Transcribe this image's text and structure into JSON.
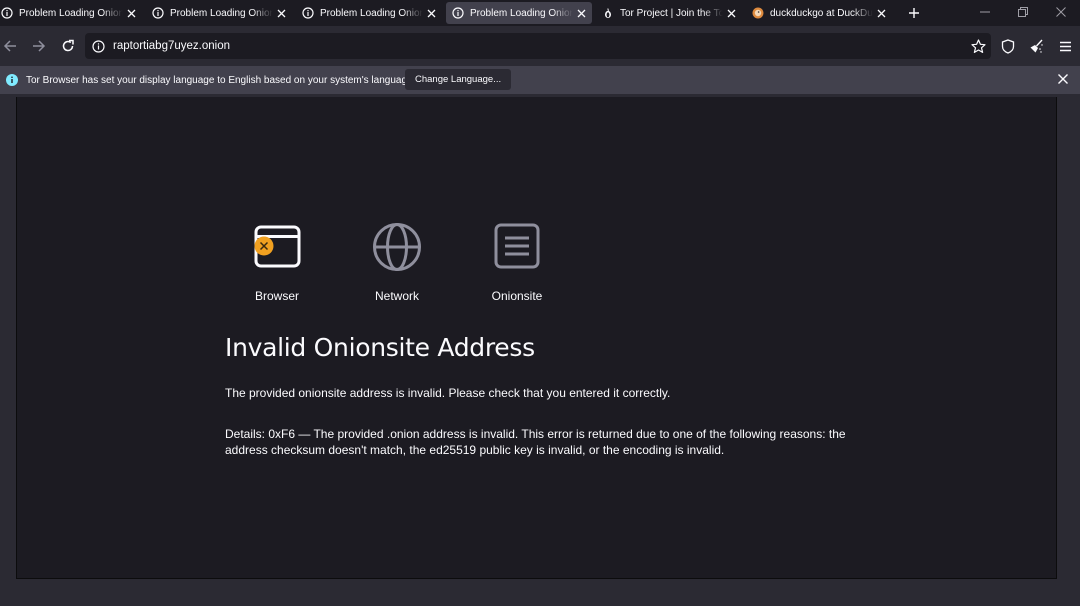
{
  "tabs": [
    {
      "title": "Problem Loading Onionsite",
      "favicon": "info-icon",
      "selected": false
    },
    {
      "title": "Problem Loading Onionsite",
      "favicon": "info-icon",
      "selected": false
    },
    {
      "title": "Problem Loading Onionsite",
      "favicon": "info-icon",
      "selected": false
    },
    {
      "title": "Problem Loading Onionsite",
      "favicon": "info-icon",
      "selected": true
    },
    {
      "title": "Tor Project | Join the Tor Sta",
      "favicon": "tor-onion-icon",
      "selected": false
    },
    {
      "title": "duckduckgo at DuckDuckGo",
      "favicon": "duckduckgo-icon",
      "selected": false
    }
  ],
  "urlbar": {
    "url": "raptortiabg7uyez.onion"
  },
  "notification": {
    "message": "Tor Browser has set your display language to English based on your system's language.",
    "button_label": "Change Language..."
  },
  "error_page": {
    "diagram": [
      {
        "label": "Browser",
        "icon": "browser-window-icon"
      },
      {
        "label": "Network",
        "icon": "globe-icon"
      },
      {
        "label": "Onionsite",
        "icon": "document-icon"
      }
    ],
    "title": "Invalid Onionsite Address",
    "description": "The provided onionsite address is invalid. Please check that you entered it correctly.",
    "details": "Details: 0xF6 — The provided .onion address is invalid. This error is returned due to one of the following reasons: the address checksum doesn't match, the ed25519 public key is invalid, or the encoding is invalid."
  },
  "colors": {
    "chrome_bg": "#1c1b22",
    "toolbar_bg": "#2b2a33",
    "selected_tab": "#42414d",
    "error_badge": "#f0a020",
    "info_blue": "#80ebff"
  }
}
